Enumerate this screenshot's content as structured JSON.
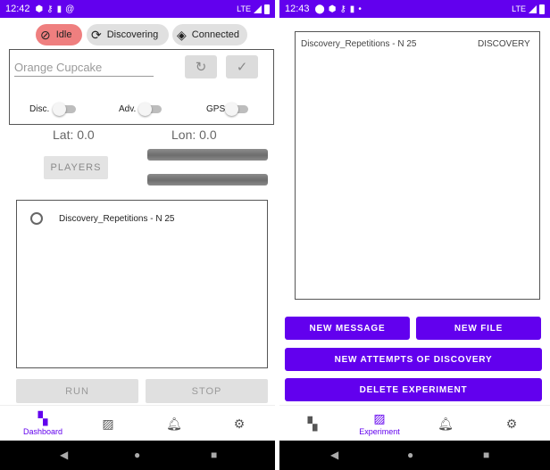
{
  "left_screen": {
    "status_bar": {
      "time": "12:42",
      "network": "LTE"
    },
    "status_chips": [
      {
        "label": "Idle",
        "icon": "block-icon"
      },
      {
        "label": "Discovering",
        "icon": "sync-icon"
      },
      {
        "label": "Connected",
        "icon": "diamond-arrow-icon"
      }
    ],
    "name_input": {
      "placeholder": "Orange Cupcake",
      "value": ""
    },
    "toggles": [
      {
        "label": "Disc.",
        "on": false
      },
      {
        "label": "Adv.",
        "on": false
      },
      {
        "label": "GPS",
        "on": false
      }
    ],
    "coords": {
      "lat": "Lat: 0.0",
      "lon": "Lon: 0.0"
    },
    "players_label": "PLAYERS",
    "experiments": [
      {
        "label": "Discovery_Repetitions - N 25",
        "selected": false
      }
    ],
    "run_label": "RUN",
    "stop_label": "STOP",
    "bottom_nav": [
      {
        "label": "Dashboard",
        "icon": "dashboard-icon",
        "active": true
      },
      {
        "label": "",
        "icon": "assignment-icon",
        "active": false
      },
      {
        "label": "",
        "icon": "bell-icon",
        "active": false
      },
      {
        "label": "",
        "icon": "gear-icon",
        "active": false
      }
    ]
  },
  "right_screen": {
    "status_bar": {
      "time": "12:43",
      "network": "LTE"
    },
    "message": {
      "title": "Discovery_Repetitions - N 25",
      "type": "DISCOVERY"
    },
    "buttons": {
      "new_message": "NEW MESSAGE",
      "new_file": "NEW FILE",
      "new_attempts": "NEW ATTEMPTS OF DISCOVERY",
      "delete_experiment": "DELETE EXPERIMENT"
    },
    "bottom_nav": [
      {
        "label": "",
        "icon": "dashboard-icon",
        "active": false
      },
      {
        "label": "Experiment",
        "icon": "assignment-icon",
        "active": true
      },
      {
        "label": "",
        "icon": "bell-icon",
        "active": false
      },
      {
        "label": "",
        "icon": "gear-icon",
        "active": false
      }
    ]
  },
  "colors": {
    "primary": "#6200ee",
    "idle_chip": "#ef7f7f",
    "disabled_button": "#e0e0e0"
  }
}
